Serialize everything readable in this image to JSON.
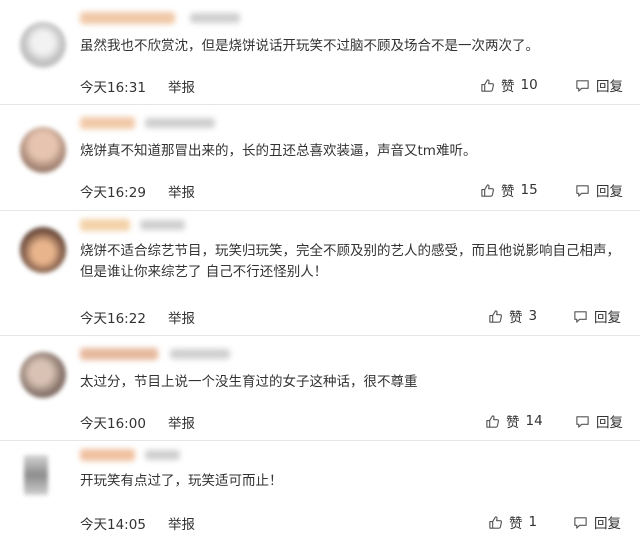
{
  "comments": [
    {
      "text": "虽然我也不欣赏沈，但是烧饼说话开玩笑不过脑不顾及场合不是一次两次了。",
      "time": "今天16:31",
      "report_label": "举报",
      "like_label": "赞",
      "like_count": "10",
      "reply_label": "回复"
    },
    {
      "text": "烧饼真不知道那冒出来的，长的丑还总喜欢装逼，声音又tm难听。",
      "time": "今天16:29",
      "report_label": "举报",
      "like_label": "赞",
      "like_count": "15",
      "reply_label": "回复"
    },
    {
      "text": "烧饼不适合综艺节目，玩笑归玩笑，完全不顾及别的艺人的感受，而且他说影响自己相声，但是谁让你来综艺了 自己不行还怪别人！",
      "time": "今天16:22",
      "report_label": "举报",
      "like_label": "赞",
      "like_count": "3",
      "reply_label": "回复"
    },
    {
      "text": "太过分，节目上说一个没生育过的女子这种话，很不尊重",
      "time": "今天16:00",
      "report_label": "举报",
      "like_label": "赞",
      "like_count": "14",
      "reply_label": "回复"
    },
    {
      "text": "开玩笑有点过了，玩笑适可而止！",
      "time": "今天14:05",
      "report_label": "举报",
      "like_label": "赞",
      "like_count": "1",
      "reply_label": "回复"
    }
  ],
  "icons": {
    "like": "thumbs-up-icon",
    "reply": "speech-bubble-icon"
  },
  "colors": {
    "text": "#333333",
    "divider": "#e6e6e6"
  }
}
